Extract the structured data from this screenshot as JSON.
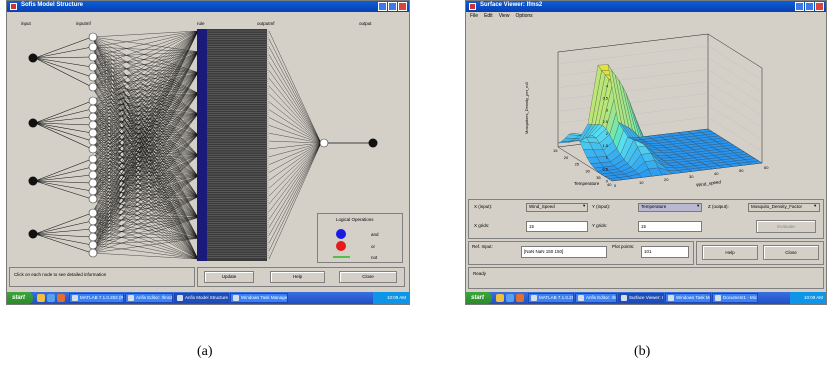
{
  "caption_a": "(a)",
  "caption_b": "(b)",
  "screenshot_a": {
    "window_title": "Sofis Model Structure",
    "column_labels": {
      "input": "input",
      "inputmf": "inputmf",
      "rule": "rule",
      "outputmf": "outputmf",
      "output": "output"
    },
    "legend": {
      "title": "Logical Operations",
      "items": [
        {
          "label": "and",
          "color": "#1a1ae6"
        },
        {
          "label": "or",
          "color": "#e61a1a"
        },
        {
          "label": "not",
          "color": "#22bb22"
        }
      ]
    },
    "status_text": "Click on each node to see detailed information",
    "buttons": {
      "update": "Update",
      "help": "Help",
      "close": "Close"
    },
    "taskbar": {
      "start": "start",
      "items": [
        "MATLAB 7.1.0.253 (R...",
        "Anfis Editor: Ifms2",
        "Anfis Model Structure",
        "Windows Task Manager"
      ],
      "active_index": 2,
      "clock": "10:09 AM"
    }
  },
  "screenshot_b": {
    "window_title": "Surface Viewer: Ifms2",
    "menu": [
      "File",
      "Edit",
      "View",
      "Options"
    ],
    "plot": {
      "z_label": "Mosquitoes_Density_per_m3",
      "x_label": "Wind_speed",
      "y_label": "Temperature",
      "z_ticks": [
        "0",
        "0.5",
        "1",
        "1.5",
        "2",
        "2.5",
        "3",
        "3.5",
        "4"
      ],
      "x_ticks": [
        "0",
        "10",
        "20",
        "30",
        "40",
        "50",
        "60"
      ],
      "y_ticks": [
        "15",
        "20",
        "25",
        "30",
        "35",
        "40"
      ]
    },
    "controls": {
      "x_input_label": "X (input):",
      "x_input_value": "Wind_Speed",
      "y_input_label": "Y (input):",
      "y_input_value": "Temperature",
      "z_output_label": "Z (output):",
      "z_output_value": "Mosquito_Density_Factor",
      "x_grids_label": "X grids:",
      "x_grids_value": "15",
      "y_grids_label": "Y grids:",
      "y_grids_value": "15",
      "evaluate": "Evaluate",
      "ref_input_label": "Ref. Input:",
      "ref_input_value": "[NaN NaN 150 150]",
      "plot_points_label": "Plot points:",
      "plot_points_value": "101",
      "help": "Help",
      "close": "Close",
      "status": "Ready"
    },
    "taskbar": {
      "start": "start",
      "items": [
        "MATLAB 7.1.0.253 (R...",
        "Anfis Editor: Ifms2",
        "Surface Viewer: Ifms2",
        "Windows Task Manager",
        "Document1 - Microsoft ..."
      ],
      "active_index": 2,
      "clock": "10:09 AM"
    }
  }
}
